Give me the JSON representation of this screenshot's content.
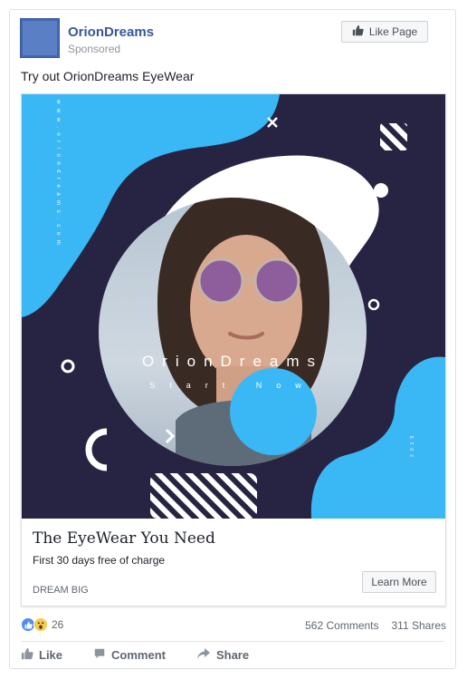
{
  "post": {
    "page_name": "OrionDreams",
    "sponsored": "Sponsored",
    "like_page_label": "Like Page",
    "text": "Try out OrionDreams EyeWear"
  },
  "ad": {
    "image": {
      "brand_text": "OrionDreams",
      "sub_text": "Start Now",
      "vertical_text_left": "www.oriondreams.com",
      "vertical_text_right": "2019"
    },
    "headline": "The EyeWear You Need",
    "description": "First 30 days free of charge",
    "caption": "DREAM BIG",
    "cta_label": "Learn More"
  },
  "engagement": {
    "reaction_count": "26",
    "comments": "562 Comments",
    "shares": "311 Shares"
  },
  "actions": {
    "like": "Like",
    "comment": "Comment",
    "share": "Share"
  },
  "icons": {
    "like_react": "like-reaction-icon",
    "wow_react": "wow-reaction-icon",
    "thumb": "thumbs-up-icon",
    "comment": "comment-bubble-icon",
    "share": "share-arrow-icon"
  },
  "colors": {
    "brand_link": "#365899",
    "ad_background": "#262442",
    "blob_blue": "#3ab8f5",
    "like_blue": "#4f8ef7"
  }
}
